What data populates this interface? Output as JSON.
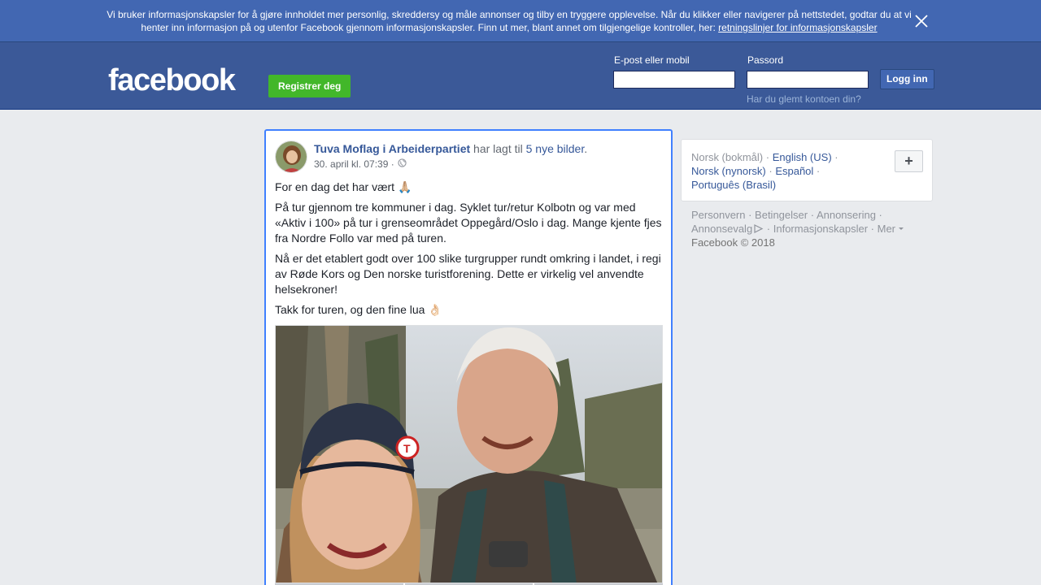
{
  "cookie_banner": {
    "text": "Vi bruker informasjonskapsler for å gjøre innholdet mer personlig, skreddersy og måle annonser og tilby en tryggere opplevelse. Når du klikker eller navigerer på nettstedet, godtar du at vi henter inn informasjon på og utenfor Facebook gjennom informasjonskapsler. Finn ut mer, blant annet om tilgjengelige kontroller, her: ",
    "link": "retningslinjer for informasjonskapsler",
    "close_icon": "close-icon"
  },
  "header": {
    "logo": "facebook",
    "register_label": "Registrer deg",
    "email_label": "E-post eller mobil",
    "email_value": "",
    "password_label": "Passord",
    "password_value": "",
    "login_label": "Logg inn",
    "forgot_label": "Har du glemt kontoen din?"
  },
  "post": {
    "author": "Tuva Moflag i Arbeiderpartiet",
    "verb": "har lagt til",
    "photos_link": "5 nye bilder",
    "period": ".",
    "timestamp": "30. april kl. 07:39 ·",
    "privacy_icon": "globe-icon",
    "paragraphs": [
      "For en dag det har vært 🙏🏼",
      "På tur gjennom tre kommuner i dag. Syklet tur/retur Kolbotn og var med «Aktiv i 100» på tur i grenseområdet Oppegård/Oslo i dag. Mange kjente fjes fra Nordre Follo var med på turen.",
      "Nå er det etablert godt over 100 slike turgrupper rundt omkring i landet, i regi av Røde Kors og Den norske turistforening. Dette er virkelig vel anvendte helsekroner!",
      "Takk for turen, og den fine lua 👌🏻"
    ]
  },
  "languages": {
    "current": "Norsk (bokmål)",
    "english": "English (US)",
    "nynorsk": "Norsk (nynorsk)",
    "spanish": "Español",
    "portuguese": "Português (Brasil)",
    "add_label": "+"
  },
  "footer": {
    "privacy": "Personvern",
    "terms": "Betingelser",
    "advertising": "Annonsering",
    "ad_choices": "Annonsevalg",
    "cookies": "Informasjonskapsler",
    "more": "Mer",
    "copyright": "Facebook © 2018"
  }
}
